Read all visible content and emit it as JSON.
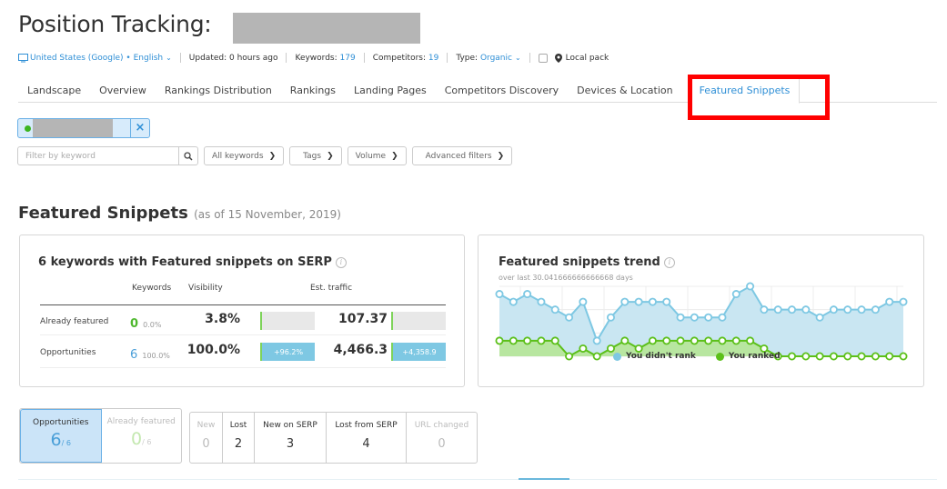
{
  "header": {
    "title": "Position Tracking:",
    "location": "United States (Google) • English",
    "updated": "Updated: 0 hours ago",
    "keywords_label": "Keywords:",
    "keywords_value": "179",
    "competitors_label": "Competitors:",
    "competitors_value": "19",
    "type_label": "Type:",
    "type_value": "Organic",
    "local_pack_label": "Local pack"
  },
  "tabs": [
    {
      "label": "Landscape"
    },
    {
      "label": "Overview"
    },
    {
      "label": "Rankings Distribution"
    },
    {
      "label": "Rankings"
    },
    {
      "label": "Landing Pages"
    },
    {
      "label": "Competitors Discovery"
    },
    {
      "label": "Devices & Location"
    },
    {
      "label": "Featured Snippets",
      "active": true
    }
  ],
  "filters": {
    "keyword_placeholder": "Filter by keyword",
    "keyword_value": "",
    "all_keywords": "All keywords",
    "tags": "Tags",
    "volume": "Volume",
    "advanced": "Advanced filters"
  },
  "section": {
    "title": "Featured Snippets",
    "subtitle": "(as of 15 November, 2019)"
  },
  "summary_card": {
    "title": "6 keywords with Featured snippets on SERP",
    "col_keywords": "Keywords",
    "col_visibility": "Visibility",
    "col_traffic": "Est. traffic",
    "rows": [
      {
        "label": "Already featured",
        "count": "0",
        "count_pct": "0.0%",
        "visibility": "3.8%",
        "visibility_delta": "",
        "visibility_fill": 0,
        "traffic": "107.37",
        "traffic_delta": "",
        "traffic_fill": 0
      },
      {
        "label": "Opportunities",
        "count": "6",
        "count_pct": "100.0%",
        "visibility": "100.0%",
        "visibility_delta": "+96.2%",
        "visibility_fill": 1.0,
        "traffic": "4,466.3",
        "traffic_delta": "+4,358.9",
        "traffic_fill": 1.0
      }
    ]
  },
  "trend_card": {
    "title": "Featured snippets trend",
    "subtitle": "over last 30.041666666666668 days",
    "legend": [
      {
        "label": "You didn't rank",
        "color": "#7ec8e3"
      },
      {
        "label": "You ranked",
        "color": "#5cc01a"
      }
    ]
  },
  "chart_data": {
    "type": "area",
    "stacked": true,
    "title": "Featured snippets trend",
    "subtitle": "over last 30.041666666666668 days",
    "legend_position": "bottom",
    "grid": true,
    "ylim": [
      0,
      9
    ],
    "x": [
      1,
      2,
      3,
      4,
      5,
      6,
      7,
      8,
      9,
      10,
      11,
      12,
      13,
      14,
      15,
      16,
      17,
      18,
      19,
      20,
      21,
      22,
      23,
      24,
      25,
      26,
      27,
      28,
      29,
      30
    ],
    "series": [
      {
        "name": "You ranked",
        "color": "#5cc01a",
        "values": [
          2,
          2,
          2,
          2,
          2,
          0,
          1,
          0,
          1,
          2,
          1,
          2,
          2,
          2,
          2,
          2,
          2,
          2,
          2,
          1,
          0,
          0,
          0,
          0,
          0,
          0,
          0,
          0,
          0,
          0
        ]
      },
      {
        "name": "You didn't rank",
        "color": "#7ec8e3",
        "values": [
          6,
          5,
          6,
          5,
          4,
          5,
          6,
          2,
          4,
          5,
          6,
          5,
          5,
          3,
          3,
          3,
          3,
          6,
          7,
          5,
          6,
          6,
          6,
          5,
          6,
          6,
          6,
          6,
          7,
          7
        ]
      }
    ]
  },
  "status_tabs": [
    {
      "label": "Opportunities",
      "value": "6",
      "total": "/ 6",
      "active": true
    },
    {
      "label": "Already featured",
      "value": "0",
      "total": "/ 6",
      "active": false
    }
  ],
  "change_tabs": [
    {
      "label": "New",
      "value": "0",
      "muted": true
    },
    {
      "label": "Lost",
      "value": "2",
      "muted": false
    },
    {
      "label": "New on SERP",
      "value": "3",
      "muted": false
    },
    {
      "label": "Lost from SERP",
      "value": "4",
      "muted": false
    },
    {
      "label": "URL changed",
      "value": "0",
      "muted": true
    }
  ]
}
